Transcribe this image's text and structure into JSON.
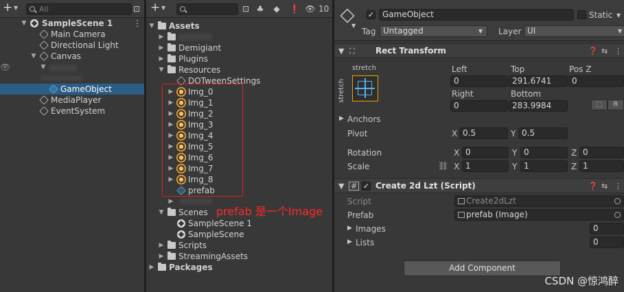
{
  "hierarchy": {
    "search_placeholder": "All",
    "scene": "SampleScene 1",
    "items": {
      "main_camera": "Main Camera",
      "directional_light": "Directional Light",
      "canvas": "Canvas",
      "gameobject": "GameObject",
      "mediaplayer": "MediaPlayer",
      "eventsystem": "EventSystem"
    }
  },
  "project": {
    "hidden_count": "10",
    "assets": "Assets",
    "demigiant": "Demigiant",
    "plugins": "Plugins",
    "resources": "Resources",
    "dotween_settings": "DOTweenSettings",
    "images": [
      "Img_0",
      "Img_1",
      "Img_2",
      "Img_3",
      "Img_4",
      "Img_5",
      "Img_6",
      "Img_7",
      "Img_8"
    ],
    "prefab": "prefab",
    "scenes": "Scenes",
    "scene_a": "SampleScene 1",
    "scene_b": "SampleScene",
    "scripts": "Scripts",
    "streaming_assets": "StreamingAssets",
    "packages": "Packages"
  },
  "annotation": "prefab 是一个Image",
  "inspector": {
    "object_name": "GameObject",
    "static_label": "Static",
    "tag_label": "Tag",
    "tag_value": "Untagged",
    "layer_label": "Layer",
    "layer_value": "UI",
    "rect_transform": {
      "title": "Rect Transform",
      "stretch_top": "stretch",
      "stretch_side": "stretch",
      "left_label": "Left",
      "left_value": "0",
      "top_label": "Top",
      "top_value": "291.6741",
      "posz_label": "Pos Z",
      "posz_value": "0",
      "right_label": "Right",
      "right_value": "0",
      "bottom_label": "Bottom",
      "bottom_value": "283.9984",
      "r_button": "R",
      "anchors_label": "Anchors",
      "pivot_label": "Pivot",
      "pivot_x": "0.5",
      "pivot_y": "0.5",
      "rotation_label": "Rotation",
      "rot_x": "0",
      "rot_y": "0",
      "rot_z": "0",
      "scale_label": "Scale",
      "scale_x": "1",
      "scale_y": "1",
      "scale_z": "1",
      "x": "X",
      "y": "Y",
      "z": "Z"
    },
    "script_comp": {
      "title": "Create 2d Lzt (Script)",
      "script_label": "Script",
      "script_value": "Create2dLzt",
      "prefab_label": "Prefab",
      "prefab_value": "prefab (Image)",
      "images_label": "Images",
      "images_value": "0",
      "lists_label": "Lists",
      "lists_value": "0"
    },
    "add_component": "Add Component"
  },
  "watermark": "CSDN @惊鸿醉"
}
